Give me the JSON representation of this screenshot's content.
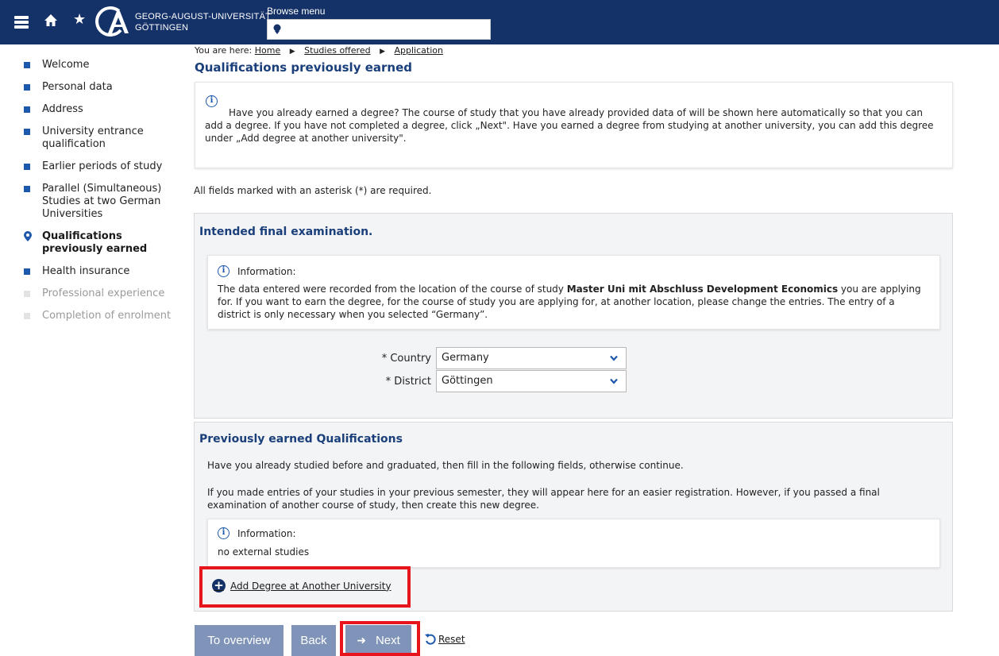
{
  "header": {
    "logo_line1": "GEORG-AUGUST-UNIVERSITÄT",
    "logo_line2": "GÖTTINGEN",
    "browse_label": "Browse menu",
    "browse_value": "",
    "colors": {
      "bar": "#153268",
      "accent": "#1e58ad"
    }
  },
  "sidebar": {
    "items": [
      {
        "label": "Welcome",
        "state": "done"
      },
      {
        "label": "Personal data",
        "state": "done"
      },
      {
        "label": "Address",
        "state": "done"
      },
      {
        "label": "University entrance qualification",
        "state": "done"
      },
      {
        "label": "Earlier periods of study",
        "state": "done"
      },
      {
        "label": "Parallel (Simultaneous) Studies at two German Universities",
        "state": "done"
      },
      {
        "label": "Qualifications previously earned",
        "state": "active"
      },
      {
        "label": "Health insurance",
        "state": "done"
      },
      {
        "label": "Professional experience",
        "state": "disabled"
      },
      {
        "label": "Completion of enrolment",
        "state": "disabled"
      }
    ]
  },
  "breadcrumb": {
    "prefix": "You are here:",
    "items": [
      "Home",
      "Studies offered",
      "Application"
    ]
  },
  "main": {
    "title": "Qualifications previously earned",
    "intro": "Have you already earned a degree? The course of study that you have already provided data of will be shown here automatically so that you can add a degree. If you have not completed a degree, click „Next\". Have you earned a degree from studying at another university, you can add this degree under „Add degree at another university\".",
    "required_note": "All fields marked with an asterisk (*) are required."
  },
  "panel_exam": {
    "title": "Intended final examination.",
    "info_heading": "Information:",
    "info_text_before": "The data entered were recorded from the location of the course of study ",
    "info_text_bold": "Master Uni mit Abschluss Development Economics",
    "info_text_after": " you are applying for. If you want to earn the degree, for the course of study you are applying for, at another location, please change the entries. The entry of a district is only necessary when you selected “Germany”.",
    "country_label": "* Country",
    "country_value": "Germany",
    "district_label": "* District",
    "district_value": "Göttingen"
  },
  "panel_prev": {
    "title": "Previously earned Qualifications",
    "text1": "Have you already studied before and graduated, then fill in the following fields, otherwise continue.",
    "text2": "If you made entries of your studies in your previous semester, they will appear here for an easier registration. However, if you passed a final examination of another course of study, then create this new degree.",
    "info_heading": "Information:",
    "info_text": "no external studies",
    "add_label": "Add Degree at Another University"
  },
  "buttons": {
    "overview": "To overview",
    "back": "Back",
    "next": "Next",
    "reset": "Reset"
  }
}
